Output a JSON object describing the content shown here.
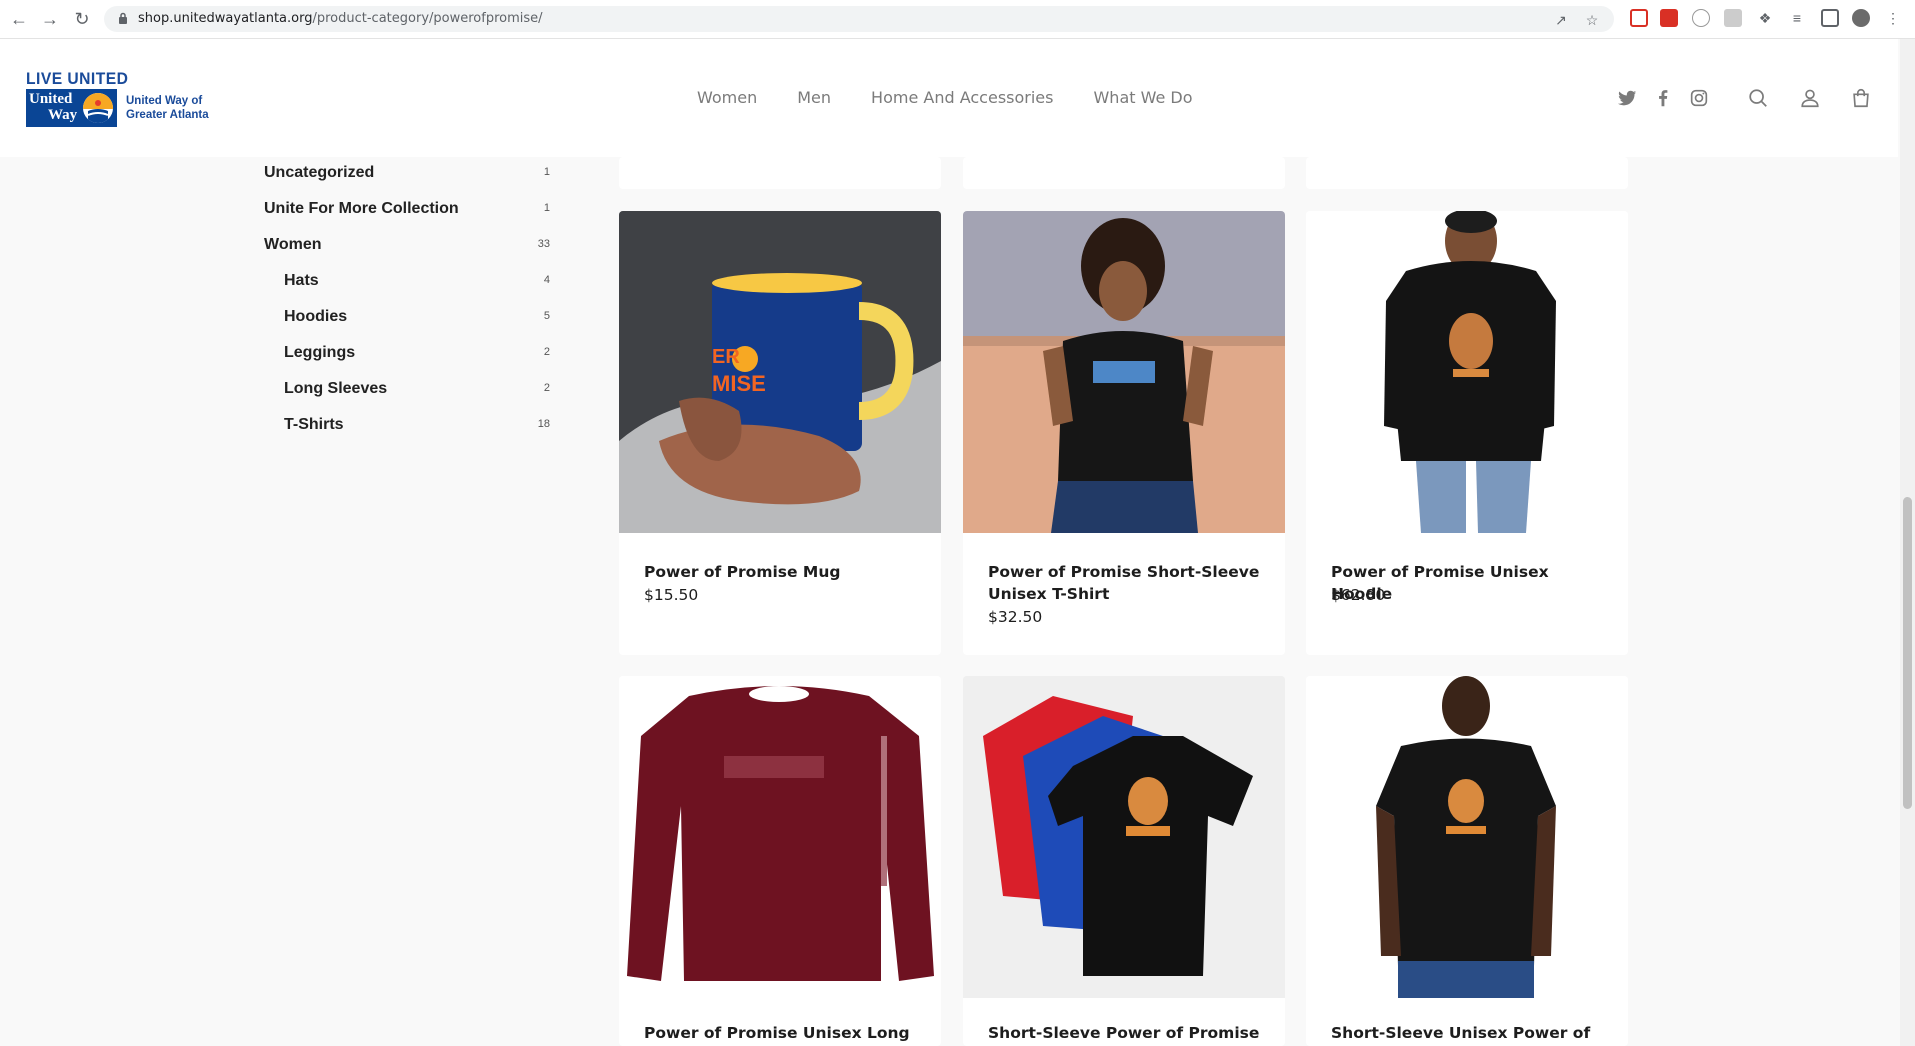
{
  "browser": {
    "url_host": "shop.unitedwayatlanta.org",
    "url_path": "/product-category/powerofpromise/"
  },
  "logo": {
    "tagline": "LIVE UNITED",
    "mark_line1": "United",
    "mark_line2": "Way",
    "org_line1": "United Way of",
    "org_line2": "Greater Atlanta"
  },
  "nav": {
    "items": [
      "Women",
      "Men",
      "Home And Accessories",
      "What We Do"
    ]
  },
  "header_icons": [
    "twitter-icon",
    "facebook-icon",
    "instagram-icon",
    "search-icon",
    "account-icon",
    "cart-icon"
  ],
  "sidebar": {
    "categories": [
      {
        "label": "Uncategorized",
        "count": "1",
        "sub": false
      },
      {
        "label": "Unite For More Collection",
        "count": "1",
        "sub": false
      },
      {
        "label": "Women",
        "count": "33",
        "sub": false
      },
      {
        "label": "Hats",
        "count": "4",
        "sub": true
      },
      {
        "label": "Hoodies",
        "count": "5",
        "sub": true
      },
      {
        "label": "Leggings",
        "count": "2",
        "sub": true
      },
      {
        "label": "Long Sleeves",
        "count": "2",
        "sub": true
      },
      {
        "label": "T-Shirts",
        "count": "18",
        "sub": true
      }
    ]
  },
  "products": [
    {
      "name": "Power of Promise Mug",
      "price": "$15.50"
    },
    {
      "name": "Power of Promise Short-Sleeve Unisex T-Shirt",
      "price": "$32.50"
    },
    {
      "name": "Power of Promise Unisex Hoodie",
      "price": "$62.80"
    },
    {
      "name": "Power of Promise Unisex Long",
      "price": ""
    },
    {
      "name": "Short-Sleeve Power of Promise",
      "price": ""
    },
    {
      "name": "Short-Sleeve Unisex Power of",
      "price": ""
    }
  ],
  "mug_text": {
    "line1": "ER",
    "line2": "MISE"
  },
  "colors": {
    "brand_blue": "#0a4595",
    "nav_gray": "#7b7b7b",
    "maroon": "#6e1221"
  }
}
